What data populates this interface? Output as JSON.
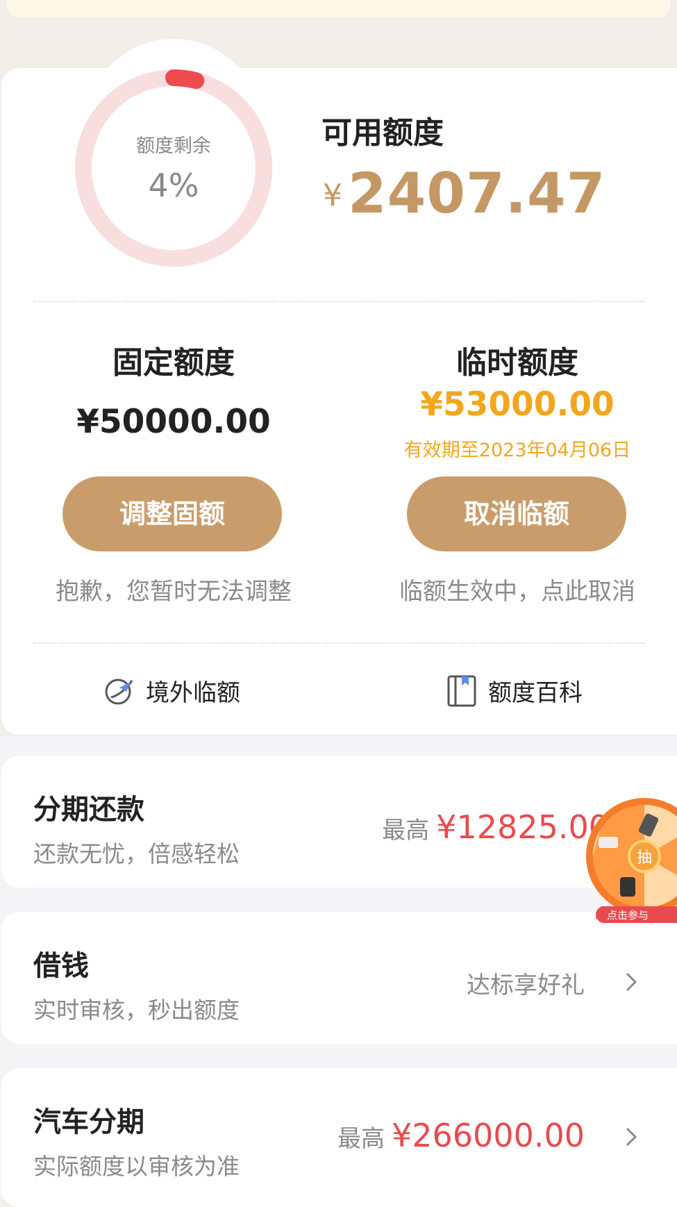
{
  "quota": {
    "gauge_label": "额度剩余",
    "gauge_percent": "4%",
    "remaining_fraction": 0.04,
    "available_title": "可用额度",
    "currency": "¥",
    "available_amount": "2407.47"
  },
  "fixed": {
    "title": "固定额度",
    "amount": "¥50000.00",
    "button": "调整固额",
    "note": "抱歉，您暂时无法调整"
  },
  "temporary": {
    "title": "临时额度",
    "amount": "¥53000.00",
    "expiry": "有效期至2023年04月06日",
    "button": "取消临额",
    "note": "临额生效中，点此取消"
  },
  "links": {
    "overseas": "境外临额",
    "encyclopedia": "额度百科"
  },
  "services": [
    {
      "title": "分期还款",
      "subtitle": "还款无忧，倍感轻松",
      "prefix": "最高",
      "value": "¥12825.00"
    },
    {
      "title": "借钱",
      "subtitle": "实时审核，秒出额度",
      "right_text": "达标享好礼"
    },
    {
      "title": "汽车分期",
      "subtitle": "实际额度以审核为准",
      "prefix": "最高",
      "value": "¥266000.00"
    }
  ],
  "lottery": {
    "center": "抽",
    "cta": "点击参与"
  },
  "colors": {
    "gold": "#c99d6b",
    "orange": "#f3a61d",
    "red": "#e94a4f",
    "gauge_track": "#f9dede",
    "gauge_fill": "#ee4b4f"
  }
}
